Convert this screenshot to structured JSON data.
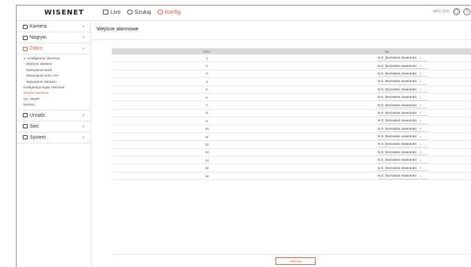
{
  "header": {
    "logo": "WISENET",
    "nav": [
      {
        "label": "Live",
        "icon": "monitor-icon"
      },
      {
        "label": "Szukaj",
        "icon": "search-icon"
      },
      {
        "label": "Konfig",
        "icon": "settings-icon",
        "active": true
      }
    ],
    "model": "HRX-1632",
    "tools": [
      {
        "icon": "user-icon",
        "glyph": "◯"
      },
      {
        "icon": "help-icon",
        "glyph": "?"
      }
    ]
  },
  "sidebar": {
    "groups_top": [
      {
        "label": "Kamera",
        "icon": "camera-icon"
      },
      {
        "label": "Nagryw.",
        "icon": "record-icon"
      },
      {
        "label": "Zdarz.",
        "icon": "event-icon",
        "active": true
      }
    ],
    "event_items": [
      {
        "label": "Konfiguracja zdarzenia",
        "level": "l1",
        "prefix": "∨"
      },
      {
        "label": "Wykrycie obiektów",
        "level": "l2"
      },
      {
        "label": "Wykrywanie maski",
        "level": "l2"
      },
      {
        "label": "Wykrywanie ruchu i IVA",
        "level": "l2"
      },
      {
        "label": "Wykrywanie sabotażu",
        "level": "l2"
      },
      {
        "label": "Konfiguracja reguły zdarzenia",
        "level": "l0"
      },
      {
        "label": "Wejście alarmowe",
        "level": "l0",
        "active": true
      },
      {
        "label": "Urz. ONVIF",
        "level": "l0"
      },
      {
        "label": "Harmon.",
        "level": "l0"
      }
    ],
    "groups_bottom": [
      {
        "label": "Urządz.",
        "icon": "device-icon"
      },
      {
        "label": "Sieć",
        "icon": "network-icon"
      },
      {
        "label": "System",
        "icon": "system-icon"
      }
    ]
  },
  "main": {
    "title": "Wejście alarmowe",
    "columns": {
      "alarm": "Alarm",
      "type": "Typ"
    },
    "rows": [
      {
        "alarm": "1",
        "type": "N.O. (Normalnie otwierante)"
      },
      {
        "alarm": "2",
        "type": "N.O. (Normalnie otwierante)"
      },
      {
        "alarm": "3",
        "type": "N.O. (Normalnie otwierante)"
      },
      {
        "alarm": "4",
        "type": "N.O. (Normalnie otwierante)"
      },
      {
        "alarm": "5",
        "type": "N.O. (Normalnie otwierante)"
      },
      {
        "alarm": "6",
        "type": "N.O. (Normalnie otwierante)"
      },
      {
        "alarm": "7",
        "type": "N.O. (Normalnie otwierante)"
      },
      {
        "alarm": "8",
        "type": "N.O. (Normalnie otwierante)"
      },
      {
        "alarm": "9",
        "type": "N.O. (Normalnie otwierante)"
      },
      {
        "alarm": "10",
        "type": "N.O. (Normalnie otwierante)"
      },
      {
        "alarm": "11",
        "type": "N.O. (Normalnie otwierante)"
      },
      {
        "alarm": "12",
        "type": "N.O. (Normalnie otwierante)"
      },
      {
        "alarm": "13",
        "type": "N.O. (Normalnie otwierante)"
      },
      {
        "alarm": "14",
        "type": "N.O. (Normalnie otwierante)"
      },
      {
        "alarm": "15",
        "type": "N.O. (Normalnie otwierante)"
      },
      {
        "alarm": "16",
        "type": "N.O. (Normalnie otwierante)"
      }
    ],
    "apply_label": "Zastosuj"
  },
  "colors": {
    "accent": "#e8553a",
    "header_row": "#d9d9d9"
  }
}
